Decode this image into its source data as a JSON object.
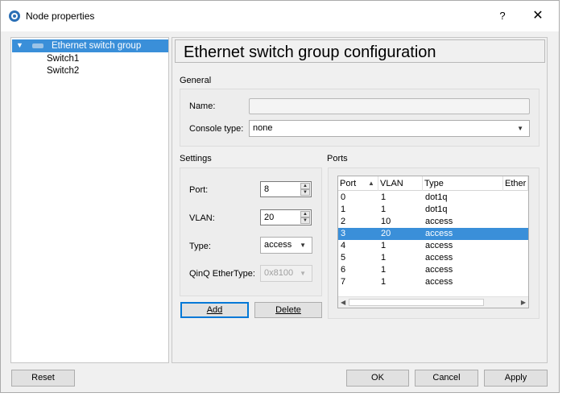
{
  "window": {
    "title": "Node properties",
    "help": "?",
    "close": "✕"
  },
  "tree": {
    "root_arrow": "▼",
    "root": "Ethernet switch group",
    "children": [
      "Switch1",
      "Switch2"
    ]
  },
  "header": {
    "title": "Ethernet switch group configuration"
  },
  "general": {
    "label": "General",
    "name_label": "Name:",
    "name_value": "",
    "console_label": "Console type:",
    "console_value": "none"
  },
  "settings": {
    "label": "Settings",
    "port_label": "Port:",
    "port_value": "8",
    "vlan_label": "VLAN:",
    "vlan_value": "20",
    "type_label": "Type:",
    "type_value": "access",
    "qinq_label": "QinQ EtherType:",
    "qinq_value": "0x8100"
  },
  "buttons": {
    "add": "Add",
    "delete": "Delete",
    "reset": "Reset",
    "ok": "OK",
    "cancel": "Cancel",
    "apply": "Apply"
  },
  "ports": {
    "label": "Ports",
    "columns": [
      "Port",
      "VLAN",
      "Type",
      "Ether"
    ],
    "rows": [
      [
        "0",
        "1",
        "dot1q"
      ],
      [
        "1",
        "1",
        "dot1q"
      ],
      [
        "2",
        "10",
        "access"
      ],
      [
        "3",
        "20",
        "access"
      ],
      [
        "4",
        "1",
        "access"
      ],
      [
        "5",
        "1",
        "access"
      ],
      [
        "6",
        "1",
        "access"
      ],
      [
        "7",
        "1",
        "access"
      ]
    ],
    "selected_row": 3
  },
  "colors": {
    "selection": "#3a8fd9",
    "default_button_border": "#0078d7"
  }
}
